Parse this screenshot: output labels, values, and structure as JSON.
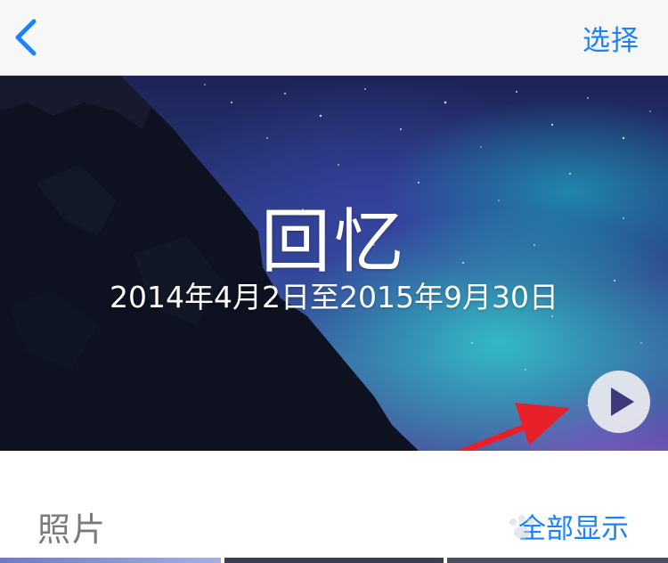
{
  "navbar": {
    "back_icon": "chevron-left-icon",
    "select_label": "选择"
  },
  "hero": {
    "title": "回忆",
    "date_range": "2014年4月2日至2015年9月30日",
    "play_icon": "play-icon"
  },
  "section": {
    "title": "照片",
    "show_all_label": "全部显示"
  },
  "colors": {
    "accent": "#1a82fb",
    "annotation_arrow": "#e8202a"
  }
}
